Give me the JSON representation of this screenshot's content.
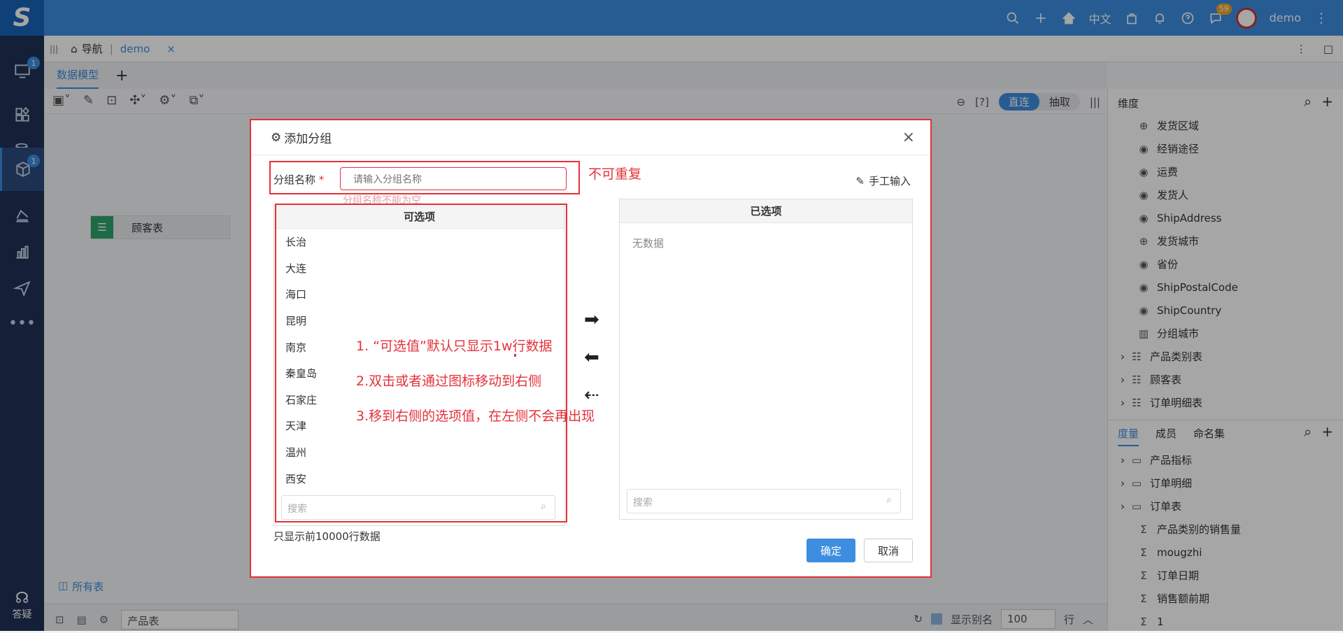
{
  "topbar": {
    "logo": "S",
    "lang": "中文",
    "chat_badge": "59",
    "user": "demo"
  },
  "sidebar": {
    "badges": [
      "1",
      "1"
    ],
    "bottom_label": "答疑"
  },
  "navbar": {
    "home": "导航",
    "tab": "demo",
    "close": "×"
  },
  "workspace": {
    "tab": "数据模型",
    "add": "+",
    "seg_direct": "直连",
    "seg_extract": "抽取",
    "help": "[?]",
    "node_label": "顾客表",
    "all_tables": "所有表",
    "bottom_input": "产品表",
    "show_alias": "显示别名",
    "rows_value": "100",
    "rows_unit": "行"
  },
  "rightpanel": {
    "dim_title": "维度",
    "dims": [
      {
        "icon": "globe-icon",
        "label": "发货区域",
        "indent": 2
      },
      {
        "icon": "eye-icon",
        "label": "经销途径",
        "indent": 2
      },
      {
        "icon": "eye-icon",
        "label": "运费",
        "indent": 2
      },
      {
        "icon": "eye-icon",
        "label": "发货人",
        "indent": 2
      },
      {
        "icon": "eye-icon",
        "label": "ShipAddress",
        "indent": 2
      },
      {
        "icon": "globe-icon",
        "label": "发货城市",
        "indent": 2
      },
      {
        "icon": "eye-icon",
        "label": "省份",
        "indent": 2
      },
      {
        "icon": "eye-icon",
        "label": "ShipPostalCode",
        "indent": 2
      },
      {
        "icon": "eye-icon",
        "label": "ShipCountry",
        "indent": 2
      },
      {
        "icon": "group-icon",
        "label": "分组城市",
        "indent": 2
      },
      {
        "icon": "table-icon",
        "label": "产品类别表",
        "indent": 1
      },
      {
        "icon": "table-icon",
        "label": "顾客表",
        "indent": 1
      },
      {
        "icon": "table-icon",
        "label": "订单明细表",
        "indent": 1
      }
    ],
    "tabs": [
      "度量",
      "成员",
      "命名集"
    ],
    "measures": [
      {
        "icon": "folder-icon",
        "label": "产品指标",
        "indent": 1
      },
      {
        "icon": "folder-icon",
        "label": "订单明细",
        "indent": 1
      },
      {
        "icon": "folder-icon",
        "label": "订单表",
        "indent": 1
      },
      {
        "icon": "sigma-icon",
        "label": "产品类别的销售量",
        "indent": 2
      },
      {
        "icon": "sigma-icon",
        "label": "mougzhi",
        "indent": 2
      },
      {
        "icon": "sigma-icon",
        "label": "订单日期",
        "indent": 2
      },
      {
        "icon": "sigma-icon",
        "label": "销售额前期",
        "indent": 2
      },
      {
        "icon": "sigma-icon",
        "label": "1",
        "indent": 2
      }
    ]
  },
  "modal": {
    "title": "添加分组",
    "close": "×",
    "name_label": "分组名称",
    "required": "*",
    "name_placeholder": "请输入分组名称",
    "name_error": "分组名称不能为空",
    "annotation_unique": "不可重复",
    "manual_input": "手工输入",
    "available_title": "可选项",
    "available": [
      "长治",
      "大连",
      "海口",
      "昆明",
      "南京",
      "秦皇岛",
      "石家庄",
      "天津",
      "温州",
      "西安"
    ],
    "selected_title": "已选项",
    "no_data": "无数据",
    "search_placeholder": "搜索",
    "annotations": [
      "1. “可选值”默认只显示1w行数据",
      "2.双击或者通过图标移动到右侧",
      "3.移到右侧的选项值，在左侧不会再出现"
    ],
    "footnote": "只显示前10000行数据",
    "ok": "确定",
    "cancel": "取消"
  }
}
